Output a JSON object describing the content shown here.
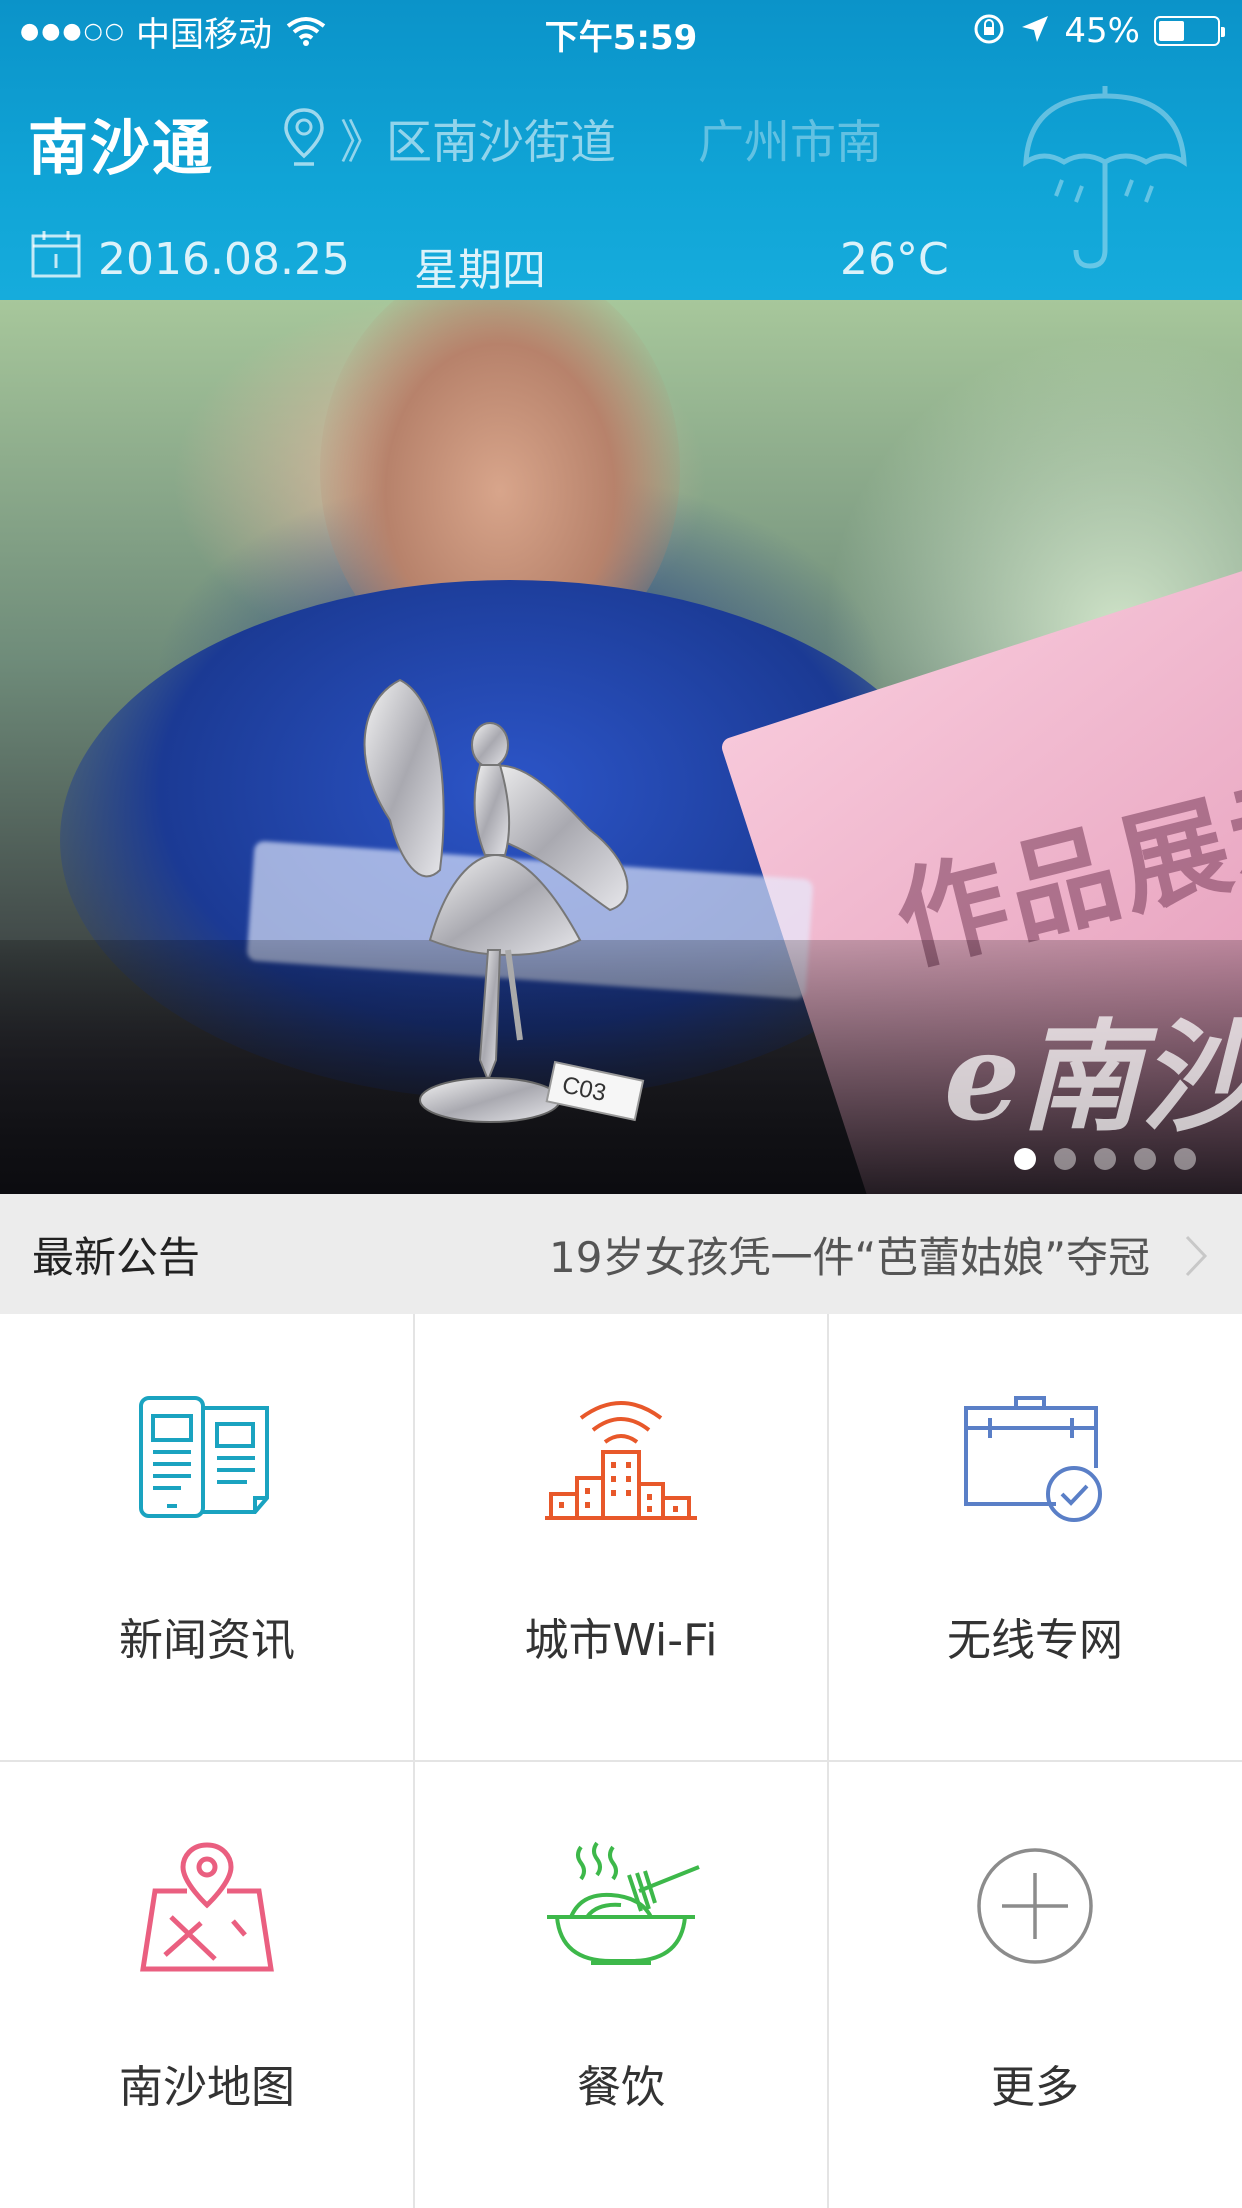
{
  "status_bar": {
    "carrier": "中国移动",
    "time": "下午5:59",
    "battery_percent": "45%",
    "battery_level": 0.45
  },
  "header": {
    "app_title": "南沙通",
    "location_primary": "》区南沙街道",
    "location_secondary": "广州市南",
    "date": "2016.08.25",
    "weekday": "星期四",
    "temperature": "26°C",
    "weather_icon": "umbrella-rain-icon"
  },
  "banner": {
    "sign_text": "作品展示",
    "tag_text": "C03",
    "watermark": "e南沙",
    "page_count": 5,
    "active_page": 1
  },
  "notice": {
    "label": "最新公告",
    "text": "19岁女孩凭一件“芭蕾姑娘”夺冠"
  },
  "menu": [
    {
      "label": "新闻资讯",
      "icon": "news-icon",
      "color": "#1aa3c0"
    },
    {
      "label": "城市Wi-Fi",
      "icon": "city-wifi-icon",
      "color": "#e8582a"
    },
    {
      "label": "无线专网",
      "icon": "toolbox-check-icon",
      "color": "#5a7fc7"
    },
    {
      "label": "南沙地图",
      "icon": "map-pin-icon",
      "color": "#ea5f80"
    },
    {
      "label": "餐饮",
      "icon": "noodle-bowl-icon",
      "color": "#3db84a"
    },
    {
      "label": "更多",
      "icon": "plus-circle-icon",
      "color": "#8c8c8c"
    }
  ]
}
